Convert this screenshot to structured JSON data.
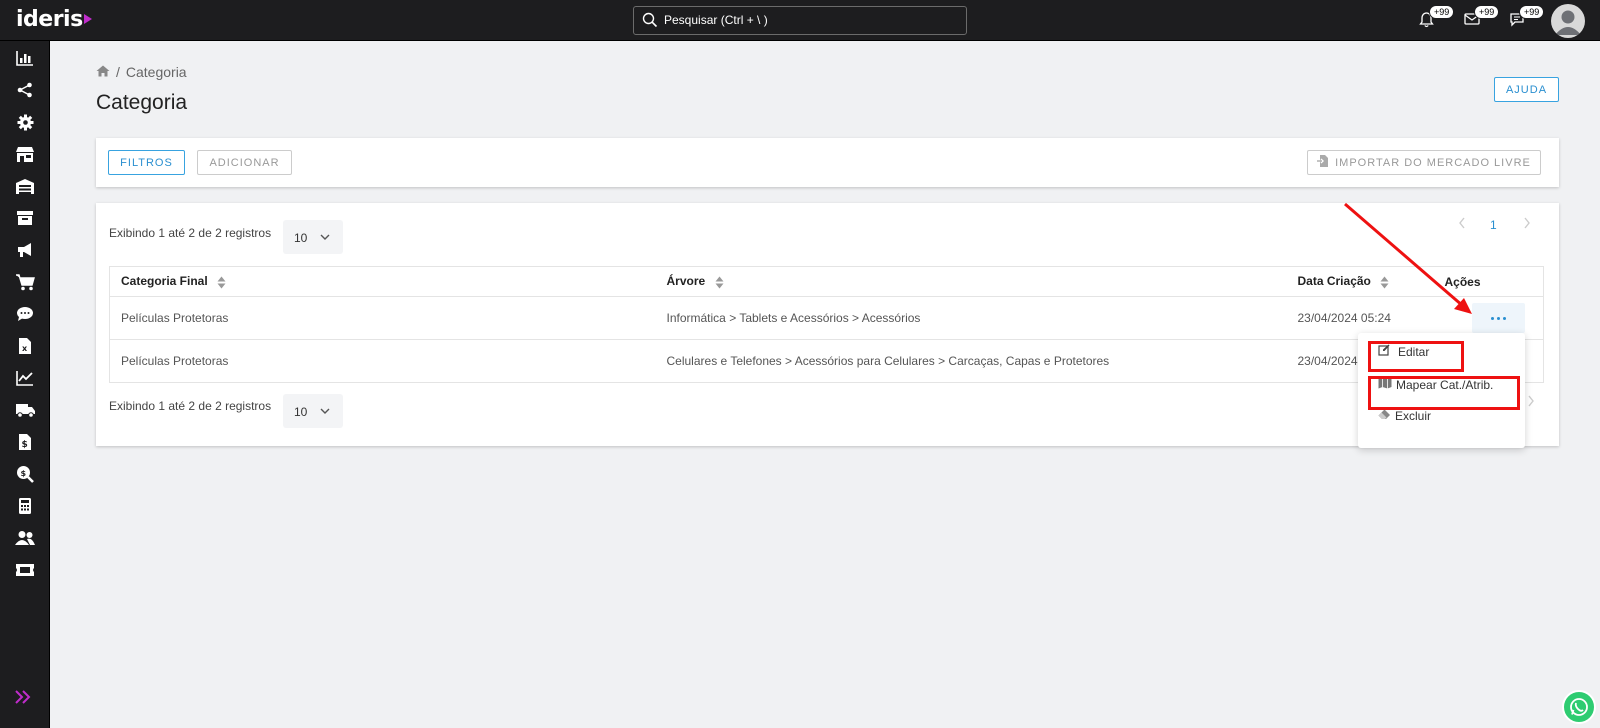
{
  "app": {
    "logo": "ideris"
  },
  "topbar": {
    "search_placeholder": "Pesquisar (Ctrl + \\ )",
    "notifications_badge": "+99",
    "mail_badge": "+99",
    "chat_badge": "+99"
  },
  "sidebar": {
    "icons": [
      "chart-bar-icon",
      "share-icon",
      "gear-icon",
      "store-icon",
      "warehouse-icon",
      "archive-icon",
      "megaphone-icon",
      "cart-icon",
      "chat-icon",
      "excel-file-icon",
      "line-chart-icon",
      "truck-icon",
      "invoice-icon",
      "search-dollar-icon",
      "calculator-icon",
      "users-icon",
      "ticket-icon"
    ]
  },
  "breadcrumb": {
    "current": "Categoria"
  },
  "page": {
    "title": "Categoria",
    "help_label": "AJUDA"
  },
  "toolbar": {
    "filters_label": "FILTROS",
    "add_label": "ADICIONAR",
    "import_label": "IMPORTAR DO MERCADO LIVRE"
  },
  "list": {
    "showing_text": "Exibindo 1 até 2 de 2 registros",
    "per_page": "10",
    "current_page": "1",
    "columns": [
      "Categoria Final",
      "Árvore",
      "Data Criação",
      "Ações"
    ],
    "rows": [
      {
        "categoria": "Películas Protetoras",
        "arvore": "Informática > Tablets e Acessórios > Acessórios",
        "data": "23/04/2024 05:24"
      },
      {
        "categoria": "Películas Protetoras",
        "arvore": "Celulares e Telefones > Acessórios para Celulares > Carcaças, Capas e Protetores",
        "data": "23/04/2024 05:24"
      }
    ]
  },
  "actions_menu": {
    "edit": "Editar",
    "map": "Mapear Cat./Atrib.",
    "delete": "Excluir"
  },
  "colors": {
    "accent": "#2a8fd0",
    "topbar_bg": "#1d1d1f",
    "highlight": "#ee1111",
    "brand_triangle": "#c02ccb",
    "whatsapp": "#2ecc71"
  }
}
